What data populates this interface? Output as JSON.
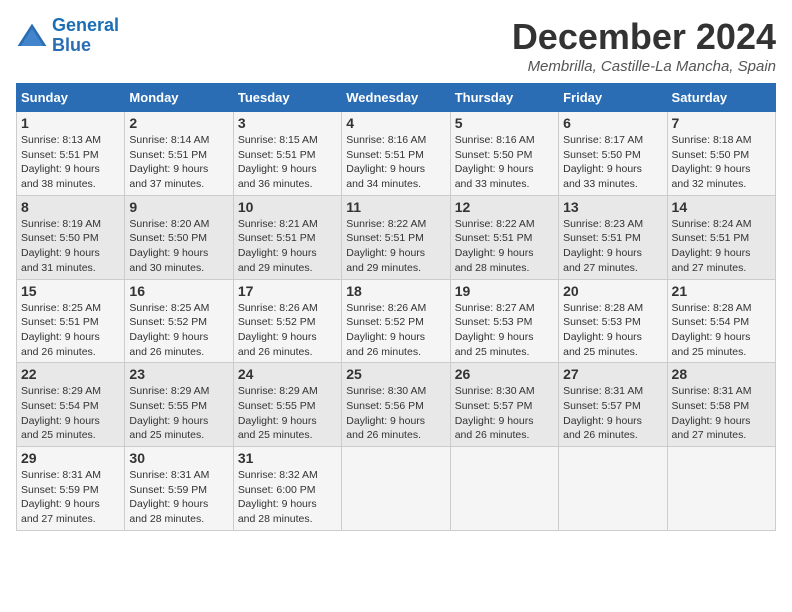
{
  "logo": {
    "line1": "General",
    "line2": "Blue"
  },
  "title": "December 2024",
  "location": "Membrilla, Castille-La Mancha, Spain",
  "weekdays": [
    "Sunday",
    "Monday",
    "Tuesday",
    "Wednesday",
    "Thursday",
    "Friday",
    "Saturday"
  ],
  "weeks": [
    [
      {
        "day": "1",
        "info": "Sunrise: 8:13 AM\nSunset: 5:51 PM\nDaylight: 9 hours\nand 38 minutes."
      },
      {
        "day": "2",
        "info": "Sunrise: 8:14 AM\nSunset: 5:51 PM\nDaylight: 9 hours\nand 37 minutes."
      },
      {
        "day": "3",
        "info": "Sunrise: 8:15 AM\nSunset: 5:51 PM\nDaylight: 9 hours\nand 36 minutes."
      },
      {
        "day": "4",
        "info": "Sunrise: 8:16 AM\nSunset: 5:51 PM\nDaylight: 9 hours\nand 34 minutes."
      },
      {
        "day": "5",
        "info": "Sunrise: 8:16 AM\nSunset: 5:50 PM\nDaylight: 9 hours\nand 33 minutes."
      },
      {
        "day": "6",
        "info": "Sunrise: 8:17 AM\nSunset: 5:50 PM\nDaylight: 9 hours\nand 33 minutes."
      },
      {
        "day": "7",
        "info": "Sunrise: 8:18 AM\nSunset: 5:50 PM\nDaylight: 9 hours\nand 32 minutes."
      }
    ],
    [
      {
        "day": "8",
        "info": "Sunrise: 8:19 AM\nSunset: 5:50 PM\nDaylight: 9 hours\nand 31 minutes."
      },
      {
        "day": "9",
        "info": "Sunrise: 8:20 AM\nSunset: 5:50 PM\nDaylight: 9 hours\nand 30 minutes."
      },
      {
        "day": "10",
        "info": "Sunrise: 8:21 AM\nSunset: 5:51 PM\nDaylight: 9 hours\nand 29 minutes."
      },
      {
        "day": "11",
        "info": "Sunrise: 8:22 AM\nSunset: 5:51 PM\nDaylight: 9 hours\nand 29 minutes."
      },
      {
        "day": "12",
        "info": "Sunrise: 8:22 AM\nSunset: 5:51 PM\nDaylight: 9 hours\nand 28 minutes."
      },
      {
        "day": "13",
        "info": "Sunrise: 8:23 AM\nSunset: 5:51 PM\nDaylight: 9 hours\nand 27 minutes."
      },
      {
        "day": "14",
        "info": "Sunrise: 8:24 AM\nSunset: 5:51 PM\nDaylight: 9 hours\nand 27 minutes."
      }
    ],
    [
      {
        "day": "15",
        "info": "Sunrise: 8:25 AM\nSunset: 5:51 PM\nDaylight: 9 hours\nand 26 minutes."
      },
      {
        "day": "16",
        "info": "Sunrise: 8:25 AM\nSunset: 5:52 PM\nDaylight: 9 hours\nand 26 minutes."
      },
      {
        "day": "17",
        "info": "Sunrise: 8:26 AM\nSunset: 5:52 PM\nDaylight: 9 hours\nand 26 minutes."
      },
      {
        "day": "18",
        "info": "Sunrise: 8:26 AM\nSunset: 5:52 PM\nDaylight: 9 hours\nand 26 minutes."
      },
      {
        "day": "19",
        "info": "Sunrise: 8:27 AM\nSunset: 5:53 PM\nDaylight: 9 hours\nand 25 minutes."
      },
      {
        "day": "20",
        "info": "Sunrise: 8:28 AM\nSunset: 5:53 PM\nDaylight: 9 hours\nand 25 minutes."
      },
      {
        "day": "21",
        "info": "Sunrise: 8:28 AM\nSunset: 5:54 PM\nDaylight: 9 hours\nand 25 minutes."
      }
    ],
    [
      {
        "day": "22",
        "info": "Sunrise: 8:29 AM\nSunset: 5:54 PM\nDaylight: 9 hours\nand 25 minutes."
      },
      {
        "day": "23",
        "info": "Sunrise: 8:29 AM\nSunset: 5:55 PM\nDaylight: 9 hours\nand 25 minutes."
      },
      {
        "day": "24",
        "info": "Sunrise: 8:29 AM\nSunset: 5:55 PM\nDaylight: 9 hours\nand 25 minutes."
      },
      {
        "day": "25",
        "info": "Sunrise: 8:30 AM\nSunset: 5:56 PM\nDaylight: 9 hours\nand 26 minutes."
      },
      {
        "day": "26",
        "info": "Sunrise: 8:30 AM\nSunset: 5:57 PM\nDaylight: 9 hours\nand 26 minutes."
      },
      {
        "day": "27",
        "info": "Sunrise: 8:31 AM\nSunset: 5:57 PM\nDaylight: 9 hours\nand 26 minutes."
      },
      {
        "day": "28",
        "info": "Sunrise: 8:31 AM\nSunset: 5:58 PM\nDaylight: 9 hours\nand 27 minutes."
      }
    ],
    [
      {
        "day": "29",
        "info": "Sunrise: 8:31 AM\nSunset: 5:59 PM\nDaylight: 9 hours\nand 27 minutes."
      },
      {
        "day": "30",
        "info": "Sunrise: 8:31 AM\nSunset: 5:59 PM\nDaylight: 9 hours\nand 28 minutes."
      },
      {
        "day": "31",
        "info": "Sunrise: 8:32 AM\nSunset: 6:00 PM\nDaylight: 9 hours\nand 28 minutes."
      },
      {
        "day": "",
        "info": ""
      },
      {
        "day": "",
        "info": ""
      },
      {
        "day": "",
        "info": ""
      },
      {
        "day": "",
        "info": ""
      }
    ]
  ]
}
